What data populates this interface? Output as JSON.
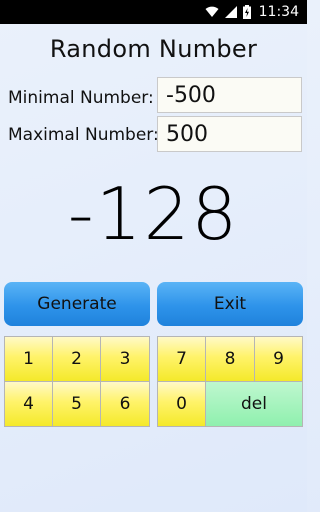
{
  "status": {
    "time": "11:34"
  },
  "app": {
    "title": "Random Number"
  },
  "form": {
    "min_label": "Minimal Number:",
    "min_value": "-500",
    "max_label": "Maximal Number:",
    "max_value": "500"
  },
  "result": "-128",
  "buttons": {
    "generate": "Generate",
    "exit": "Exit"
  },
  "keypad": {
    "k1": "1",
    "k2": "2",
    "k3": "3",
    "k4": "4",
    "k5": "5",
    "k6": "6",
    "k7": "7",
    "k8": "8",
    "k9": "9",
    "k0": "0",
    "del": "del"
  },
  "colors": {
    "button": "#2e93ea",
    "key_yellow": "#fff36a",
    "key_green": "#8ff0ae",
    "status_bar": "#000000"
  }
}
